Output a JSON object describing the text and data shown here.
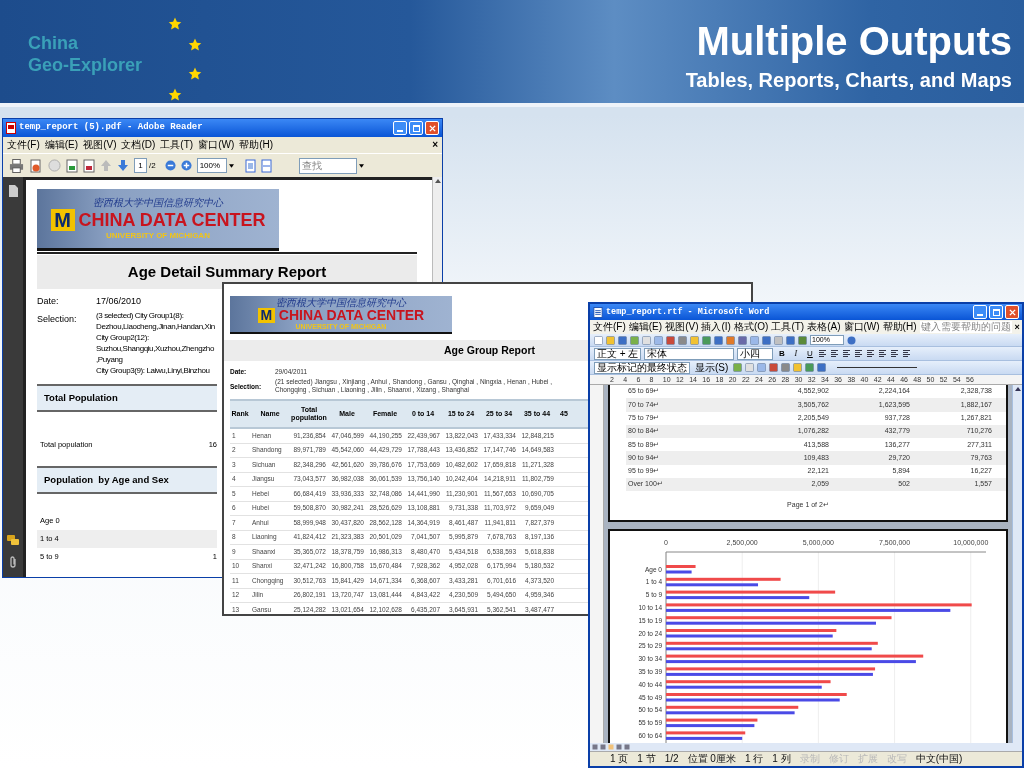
{
  "slide_header": {
    "logo_line_1": "China",
    "logo_line_2": "Geo-Explorer",
    "title": "Multiple Outputs",
    "subtitle": "Tables, Reports, Charts, and Maps"
  },
  "reader_window": {
    "title": "temp_report (5).pdf - Adobe Reader",
    "menu": [
      "文件(F)",
      "编辑(E)",
      "视图(V)",
      "文档(D)",
      "工具(T)",
      "窗口(W)",
      "帮助(H)"
    ],
    "menu_close": "×",
    "page_number": "1",
    "page_count": "/2",
    "zoom": "100%",
    "search_placeholder": "查找",
    "report": {
      "banner_chinese": "密西根大学中国信息研究中心",
      "banner_letter": "M",
      "banner_title": "CHINA DATA CENTER",
      "banner_subtitle": "UNIVERSITY OF MICHIGAN",
      "title": "Age Detail Summary Report",
      "date_label": "Date:",
      "date": "17/06/2010",
      "selection_label": "Selection:",
      "selection_lines": [
        "(3 selected) City Group1(8):",
        "Dezhou,Liaocheng,Jinan,Handan,Xin",
        "City Group2(12):",
        "Suzhou,Shangqiu,Xuzhou,Zhengzho",
        ",Puyang",
        "City Group3(9): Laiwu,Linyi,Binzhou"
      ],
      "sections": [
        {
          "heading": "Total Population",
          "rows": [
            {
              "label": "Total population",
              "value": "16"
            }
          ]
        },
        {
          "heading": "Population  by Age and Sex",
          "rows": [
            {
              "label": "Age 0"
            },
            {
              "label": "1 to 4"
            },
            {
              "label": "5 to 9",
              "value": "1"
            }
          ]
        }
      ]
    }
  },
  "report_window": {
    "banner_chinese": "密西根大学中国信息研究中心",
    "banner_letter": "M",
    "banner_title": "CHINA DATA CENTER",
    "banner_subtitle": "UNIVERSITY OF MICHIGAN",
    "title": "Age Group Report",
    "date_label": "Date:",
    "date": "29/04/2011",
    "selection_label": "Selection:",
    "selection_lines": [
      "(21 selected) Jiangsu , Xinjiang , Anhui , Shandong , Gansu , Qinghai , Ningxia , Henan , Hubei ,",
      "Chongqing , Sichuan , Liaoning , Jilin , Shaanxi , Xizang , Shanghai"
    ],
    "columns": [
      "Rank",
      "Name",
      "Total population",
      "Male",
      "Female",
      "0 to 14",
      "15 to 24",
      "25 to 34",
      "35 to 44",
      "45"
    ],
    "rows": [
      [
        "1",
        "Henan",
        "91,236,854",
        "47,046,599",
        "44,190,255",
        "22,439,967",
        "13,822,043",
        "17,433,334",
        "12,848,215"
      ],
      [
        "2",
        "Shandong",
        "89,971,789",
        "45,542,060",
        "44,429,729",
        "17,788,443",
        "13,436,852",
        "17,147,746",
        "14,649,583"
      ],
      [
        "3",
        "Sichuan",
        "82,348,296",
        "42,561,620",
        "39,786,676",
        "17,753,669",
        "10,482,602",
        "17,659,818",
        "11,271,328"
      ],
      [
        "4",
        "Jiangsu",
        "73,043,577",
        "36,982,038",
        "36,061,539",
        "13,756,140",
        "10,242,404",
        "14,218,911",
        "11,802,759"
      ],
      [
        "5",
        "Hebei",
        "66,684,419",
        "33,936,333",
        "32,748,086",
        "14,441,990",
        "11,230,901",
        "11,567,653",
        "10,690,705"
      ],
      [
        "6",
        "Hubei",
        "59,508,870",
        "30,982,241",
        "28,526,629",
        "13,108,881",
        "9,731,338",
        "11,703,972",
        "9,659,049"
      ],
      [
        "7",
        "Anhui",
        "58,999,948",
        "30,437,820",
        "28,562,128",
        "14,364,919",
        "8,461,487",
        "11,941,811",
        "7,827,379"
      ],
      [
        "8",
        "Liaoning",
        "41,824,412",
        "21,323,383",
        "20,501,029",
        "7,041,507",
        "5,995,879",
        "7,678,763",
        "8,197,136"
      ],
      [
        "9",
        "Shaanxi",
        "35,365,072",
        "18,378,759",
        "16,986,313",
        "8,480,470",
        "5,434,518",
        "6,538,593",
        "5,618,838"
      ],
      [
        "10",
        "Shanxi",
        "32,471,242",
        "16,800,758",
        "15,670,484",
        "7,928,362",
        "4,952,028",
        "6,175,994",
        "5,180,532"
      ],
      [
        "11",
        "Chongqing",
        "30,512,763",
        "15,841,429",
        "14,671,334",
        "6,368,607",
        "3,433,281",
        "6,701,616",
        "4,373,520"
      ],
      [
        "12",
        "Jilin",
        "26,802,191",
        "13,720,747",
        "13,081,444",
        "4,843,422",
        "4,230,509",
        "5,494,650",
        "4,959,346"
      ],
      [
        "13",
        "Gansu",
        "25,124,282",
        "13,021,654",
        "12,102,628",
        "6,435,207",
        "3,645,931",
        "5,362,541",
        "3,487,477"
      ]
    ]
  },
  "word_window": {
    "title": "temp_report.rtf - Microsoft Word",
    "menu": [
      "文件(F)",
      "编辑(E)",
      "视图(V)",
      "插入(I)",
      "格式(O)",
      "工具(T)",
      "表格(A)",
      "窗口(W)",
      "帮助(H)"
    ],
    "help_placeholder": "键入需要帮助的问题",
    "menu_close": "×",
    "zoom": "100%",
    "style": "正文 + 左",
    "font": "宋体",
    "font_size": "小四",
    "format_buttons": [
      "B",
      "I",
      "U"
    ],
    "markup_view": "显示标记的最终状态",
    "show_button": "显示(S)",
    "ruler_labels": [
      "2",
      "4",
      "6",
      "8",
      "10",
      "12",
      "14",
      "16",
      "18",
      "20",
      "22",
      "24",
      "26",
      "28",
      "30",
      "32",
      "34",
      "36",
      "38",
      "40",
      "42",
      "44",
      "46",
      "48",
      "50",
      "52",
      "54",
      "56"
    ],
    "table_rows": [
      [
        "65 to 69↵",
        "4,552,902",
        "2,224,164",
        "2,328,738"
      ],
      [
        "70 to 74↵",
        "3,505,762",
        "1,623,595",
        "1,882,167"
      ],
      [
        "75 to 79↵",
        "2,205,549",
        "937,728",
        "1,267,821"
      ],
      [
        "80 to 84↵",
        "1,076,282",
        "432,779",
        "710,276"
      ],
      [
        "85 to 89↵",
        "413,588",
        "136,277",
        "277,311"
      ],
      [
        "90 to 94↵",
        "109,483",
        "29,720",
        "79,763"
      ],
      [
        "95 to 99↵",
        "22,121",
        "5,894",
        "16,227"
      ],
      [
        "Over 100↵",
        "2,059",
        "502",
        "1,557"
      ]
    ],
    "page_footer": "Page 1 of 2↵",
    "chart_data": {
      "type": "bar",
      "orientation": "horizontal",
      "categories": [
        "Age 0",
        "1 to 4",
        "5 to 9",
        "10 to 14",
        "15 to 19",
        "20 to 24",
        "25 to 29",
        "30 to 34",
        "35 to 39",
        "40 to 44",
        "45 to 49",
        "50 to 54",
        "55 to 59",
        "60 to 64"
      ],
      "series": [
        {
          "color": "#f04a4a",
          "values": [
            970000,
            3760000,
            5550000,
            10030000,
            7400000,
            5590000,
            6950000,
            8440000,
            6860000,
            5400000,
            5930000,
            4340000,
            3000000,
            2600000
          ]
        },
        {
          "color": "#4a4ae6",
          "values": [
            840000,
            3020000,
            4700000,
            9330000,
            6890000,
            5470000,
            6750000,
            8200000,
            6790000,
            5110000,
            5700000,
            4220000,
            2900000,
            2500000
          ]
        }
      ],
      "xlim": [
        0,
        10500000
      ],
      "grid": true,
      "xticks": [
        {
          "value": 0,
          "label": "0"
        },
        {
          "value": 2500000,
          "label": "2,500,000"
        },
        {
          "value": 5000000,
          "label": "5,000,000"
        },
        {
          "value": 7500000,
          "label": "7,500,000"
        },
        {
          "value": 10000000,
          "label": "10,000,000"
        }
      ]
    },
    "status_bar": [
      {
        "label": "1 页",
        "active": true
      },
      {
        "label": "1 节",
        "active": true
      },
      {
        "label": "1/2",
        "active": true
      },
      {
        "label": "位置 0厘米",
        "active": true
      },
      {
        "label": "1 行",
        "active": true
      },
      {
        "label": "1 列",
        "active": true
      },
      {
        "label": "录制",
        "active": false
      },
      {
        "label": "修订",
        "active": false
      },
      {
        "label": "扩展",
        "active": false
      },
      {
        "label": "改写",
        "active": false
      },
      {
        "label": "中文(中国)",
        "active": true
      }
    ]
  }
}
